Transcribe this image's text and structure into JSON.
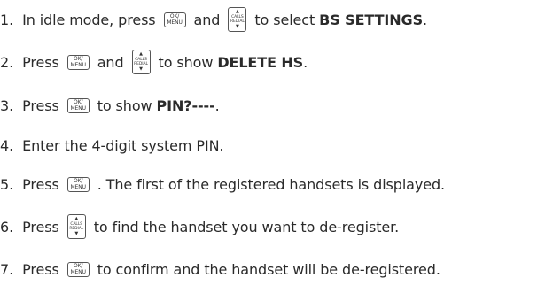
{
  "steps": [
    {
      "num": "1.",
      "before": "In idle mode, press",
      "and": "and",
      "after": "to select",
      "bold": "BS SETTINGS",
      "end": "."
    },
    {
      "num": "2.",
      "before": "Press",
      "and": "and",
      "after": "to show",
      "bold": "DELETE HS",
      "end": "."
    },
    {
      "num": "3.",
      "before": "Press",
      "after": "to show",
      "bold": "PIN?----",
      "end": "."
    },
    {
      "num": "4.",
      "text": "Enter the 4-digit system PIN."
    },
    {
      "num": "5.",
      "before": "Press",
      "after": ". The first of the registered handsets is displayed."
    },
    {
      "num": "6.",
      "before": "Press",
      "after": "to find the handset you want to de-register."
    },
    {
      "num": "7.",
      "before": "Press",
      "after": "to confirm and the handset will be de-registered."
    }
  ],
  "keys": {
    "ok_top": "OK/",
    "ok_bottom": "MENU",
    "calls_top": "CALLS",
    "calls_bottom": "REDIAL",
    "up_arrow": "▲",
    "down_arrow": "▼"
  }
}
